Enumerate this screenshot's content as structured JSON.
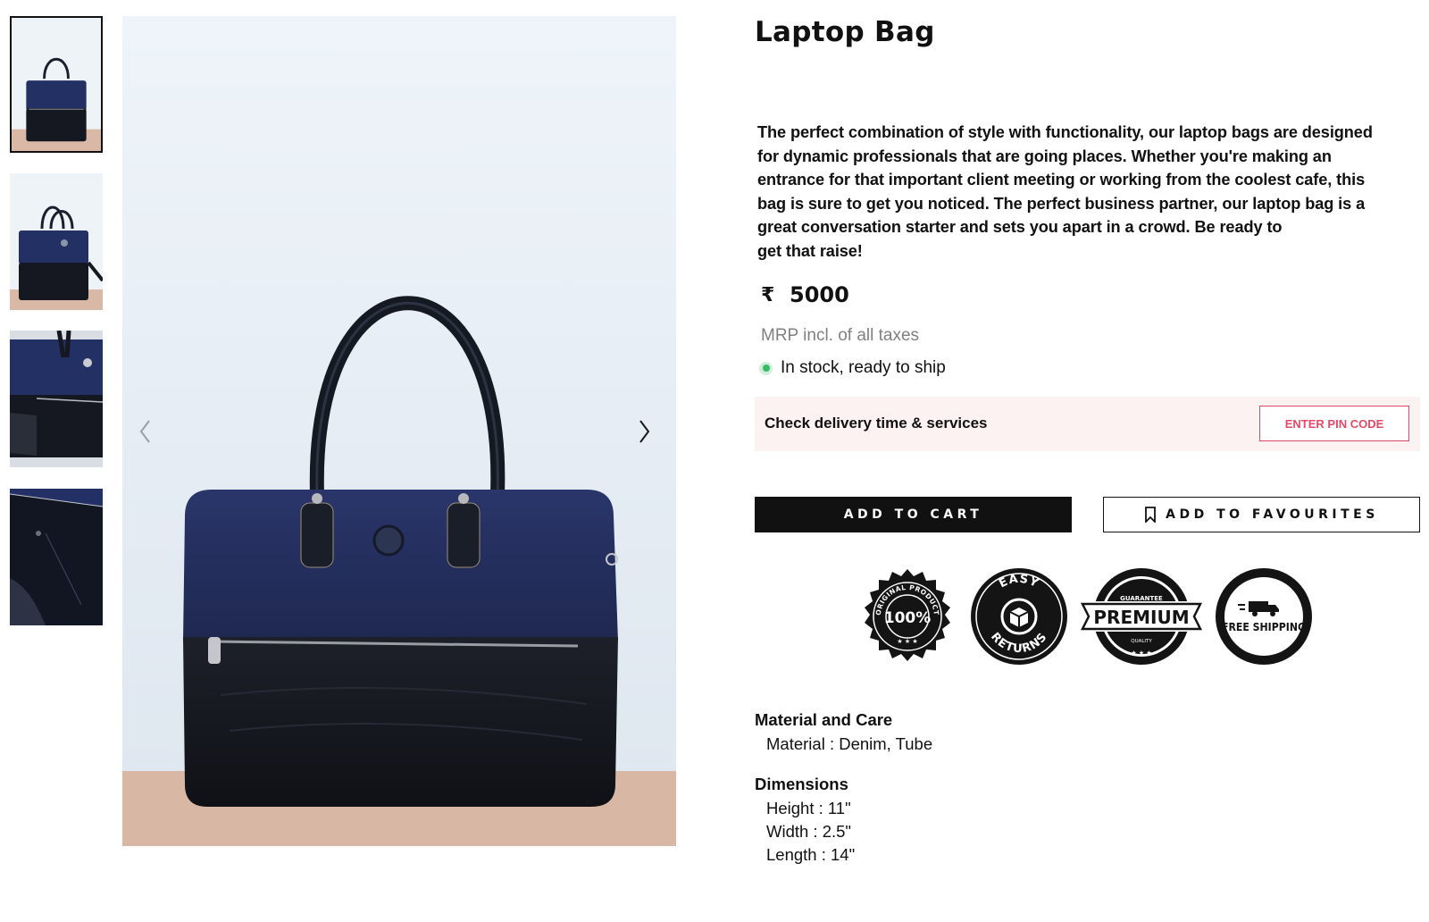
{
  "product": {
    "title": "Laptop Bag",
    "description_lines": [
      "The perfect combination of style with functionality, our laptop bags are designed",
      "for dynamic professionals that are going places. Whether you're making an",
      "entrance for that important client meeting or working from the coolest cafe, this",
      "bag is sure to get you noticed. The perfect business partner, our laptop bag is a",
      "great conversation starter and sets you apart in a crowd. Be ready to",
      "get that raise!"
    ],
    "currency_symbol": "₹",
    "price": "5000",
    "mrp_note": "MRP incl. of all taxes",
    "stock_status": "In stock, ready to ship"
  },
  "delivery": {
    "label": "Check delivery time & services",
    "pin_button": "ENTER PIN CODE"
  },
  "actions": {
    "add_to_cart": "ADD TO CART",
    "add_to_favourites": "ADD TO FAVOURITES"
  },
  "badges": {
    "original": {
      "top_text": "ORIGINAL PRODUCT",
      "center_text": "100%"
    },
    "returns": {
      "top_text": "EASY",
      "bottom_text": "RETURNS"
    },
    "premium": {
      "top_text": "GUARANTEE",
      "center_text": "PREMIUM",
      "bottom_text": "QUALITY"
    },
    "shipping": {
      "center_text": "FREE SHIPPING"
    }
  },
  "details": {
    "material_heading": "Material and Care",
    "material_value": "Material : Denim, Tube",
    "dimensions_heading": "Dimensions",
    "dimensions": [
      "Height : 11\"",
      "Width : 2.5\"",
      "Length : 14\""
    ]
  },
  "gallery": {
    "thumbnail_count": 4,
    "selected_index": 0,
    "icons": {
      "prev": "chevron-left-icon",
      "next": "chevron-right-icon",
      "bookmark": "bookmark-icon"
    }
  },
  "colors": {
    "accent_pink": "#e34a68",
    "delivery_bg": "#fdf2f2",
    "stock_green": "#3dbb62",
    "denim": "#1f2a55",
    "leather": "#15181f"
  }
}
